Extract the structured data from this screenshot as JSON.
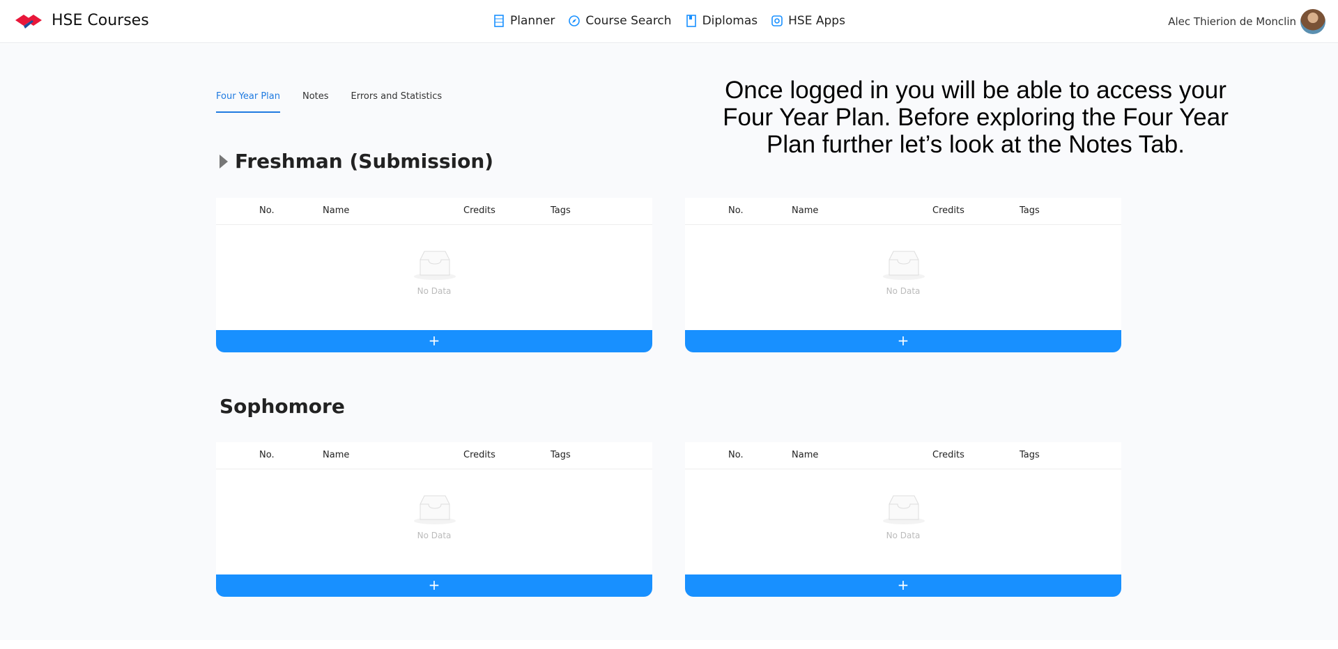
{
  "header": {
    "brand": "HSE Courses",
    "nav": [
      {
        "label": "Planner",
        "icon": "planner-icon"
      },
      {
        "label": "Course Search",
        "icon": "compass-icon"
      },
      {
        "label": "Diplomas",
        "icon": "book-icon"
      },
      {
        "label": "HSE Apps",
        "icon": "instagram-icon"
      }
    ],
    "user": "Alec Thierion de Monclin"
  },
  "tabs": [
    {
      "label": "Four Year Plan",
      "active": true
    },
    {
      "label": "Notes"
    },
    {
      "label": "Errors and Statistics"
    }
  ],
  "overlay": "Once logged in you will be able to access your Four Year Plan. Before exploring the Four Year Plan further let’s look at the Notes Tab.",
  "sections": [
    {
      "title": "Freshman (Submission)"
    },
    {
      "title": "Sophomore"
    }
  ],
  "table": {
    "columns": [
      "No.",
      "Name",
      "Credits",
      "Tags"
    ],
    "empty": "No Data",
    "add": "+"
  },
  "colors": {
    "accent": "#1890ff",
    "logo": "#e8173a"
  }
}
